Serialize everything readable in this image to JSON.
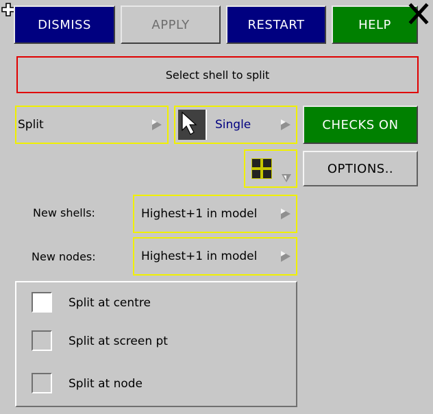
{
  "toolbar": {
    "dismiss_label": "DISMISS",
    "apply_label": "APPLY",
    "restart_label": "RESTART",
    "help_label": "HELP",
    "close_glyph": "✕"
  },
  "prompt": "Select shell to split",
  "mode_select": {
    "value": "Split"
  },
  "pick_select": {
    "value": "Single"
  },
  "checks_button": "CHECKS ON",
  "options_button": "OPTIONS..",
  "new_shells": {
    "label": "New shells:",
    "value": "Highest+1 in model"
  },
  "new_nodes": {
    "label": "New nodes:",
    "value": "Highest+1 in model"
  },
  "split_options": [
    {
      "label": "Split at centre",
      "checked": true
    },
    {
      "label": "Split at screen pt",
      "checked": false
    },
    {
      "label": "Split at node",
      "checked": false
    }
  ],
  "colors": {
    "panel_bg": "#c8c8c8",
    "button_blue": "#000080",
    "button_green": "#008000",
    "highlight_yellow": "#f0f000",
    "prompt_border": "#e00000"
  },
  "icons": [
    "move-cross-icon",
    "close-icon",
    "dropdown-arrow-icon",
    "cursor-pick-icon",
    "grid-icon"
  ]
}
